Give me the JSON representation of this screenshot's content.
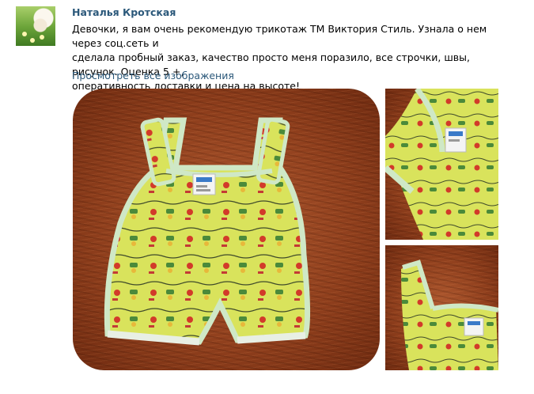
{
  "post": {
    "author": "Наталья Кротская",
    "text": "Девочки, я вам очень рекомендую трикотаж ТМ Виктория Стиль. Узнала о нем через соц.сеть и\nсделала пробный заказ, качество просто меня поразило, все строчки, швы, рисунок. Оценка 5 +,\nоперативность доставки и цена на высоте!",
    "view_all_link": "Просмотреть все изображения"
  },
  "colors": {
    "link": "#2b587a",
    "fabric": "#d8e25a",
    "trim": "#cfe8c6",
    "background_wood": "#8e3e1c"
  }
}
